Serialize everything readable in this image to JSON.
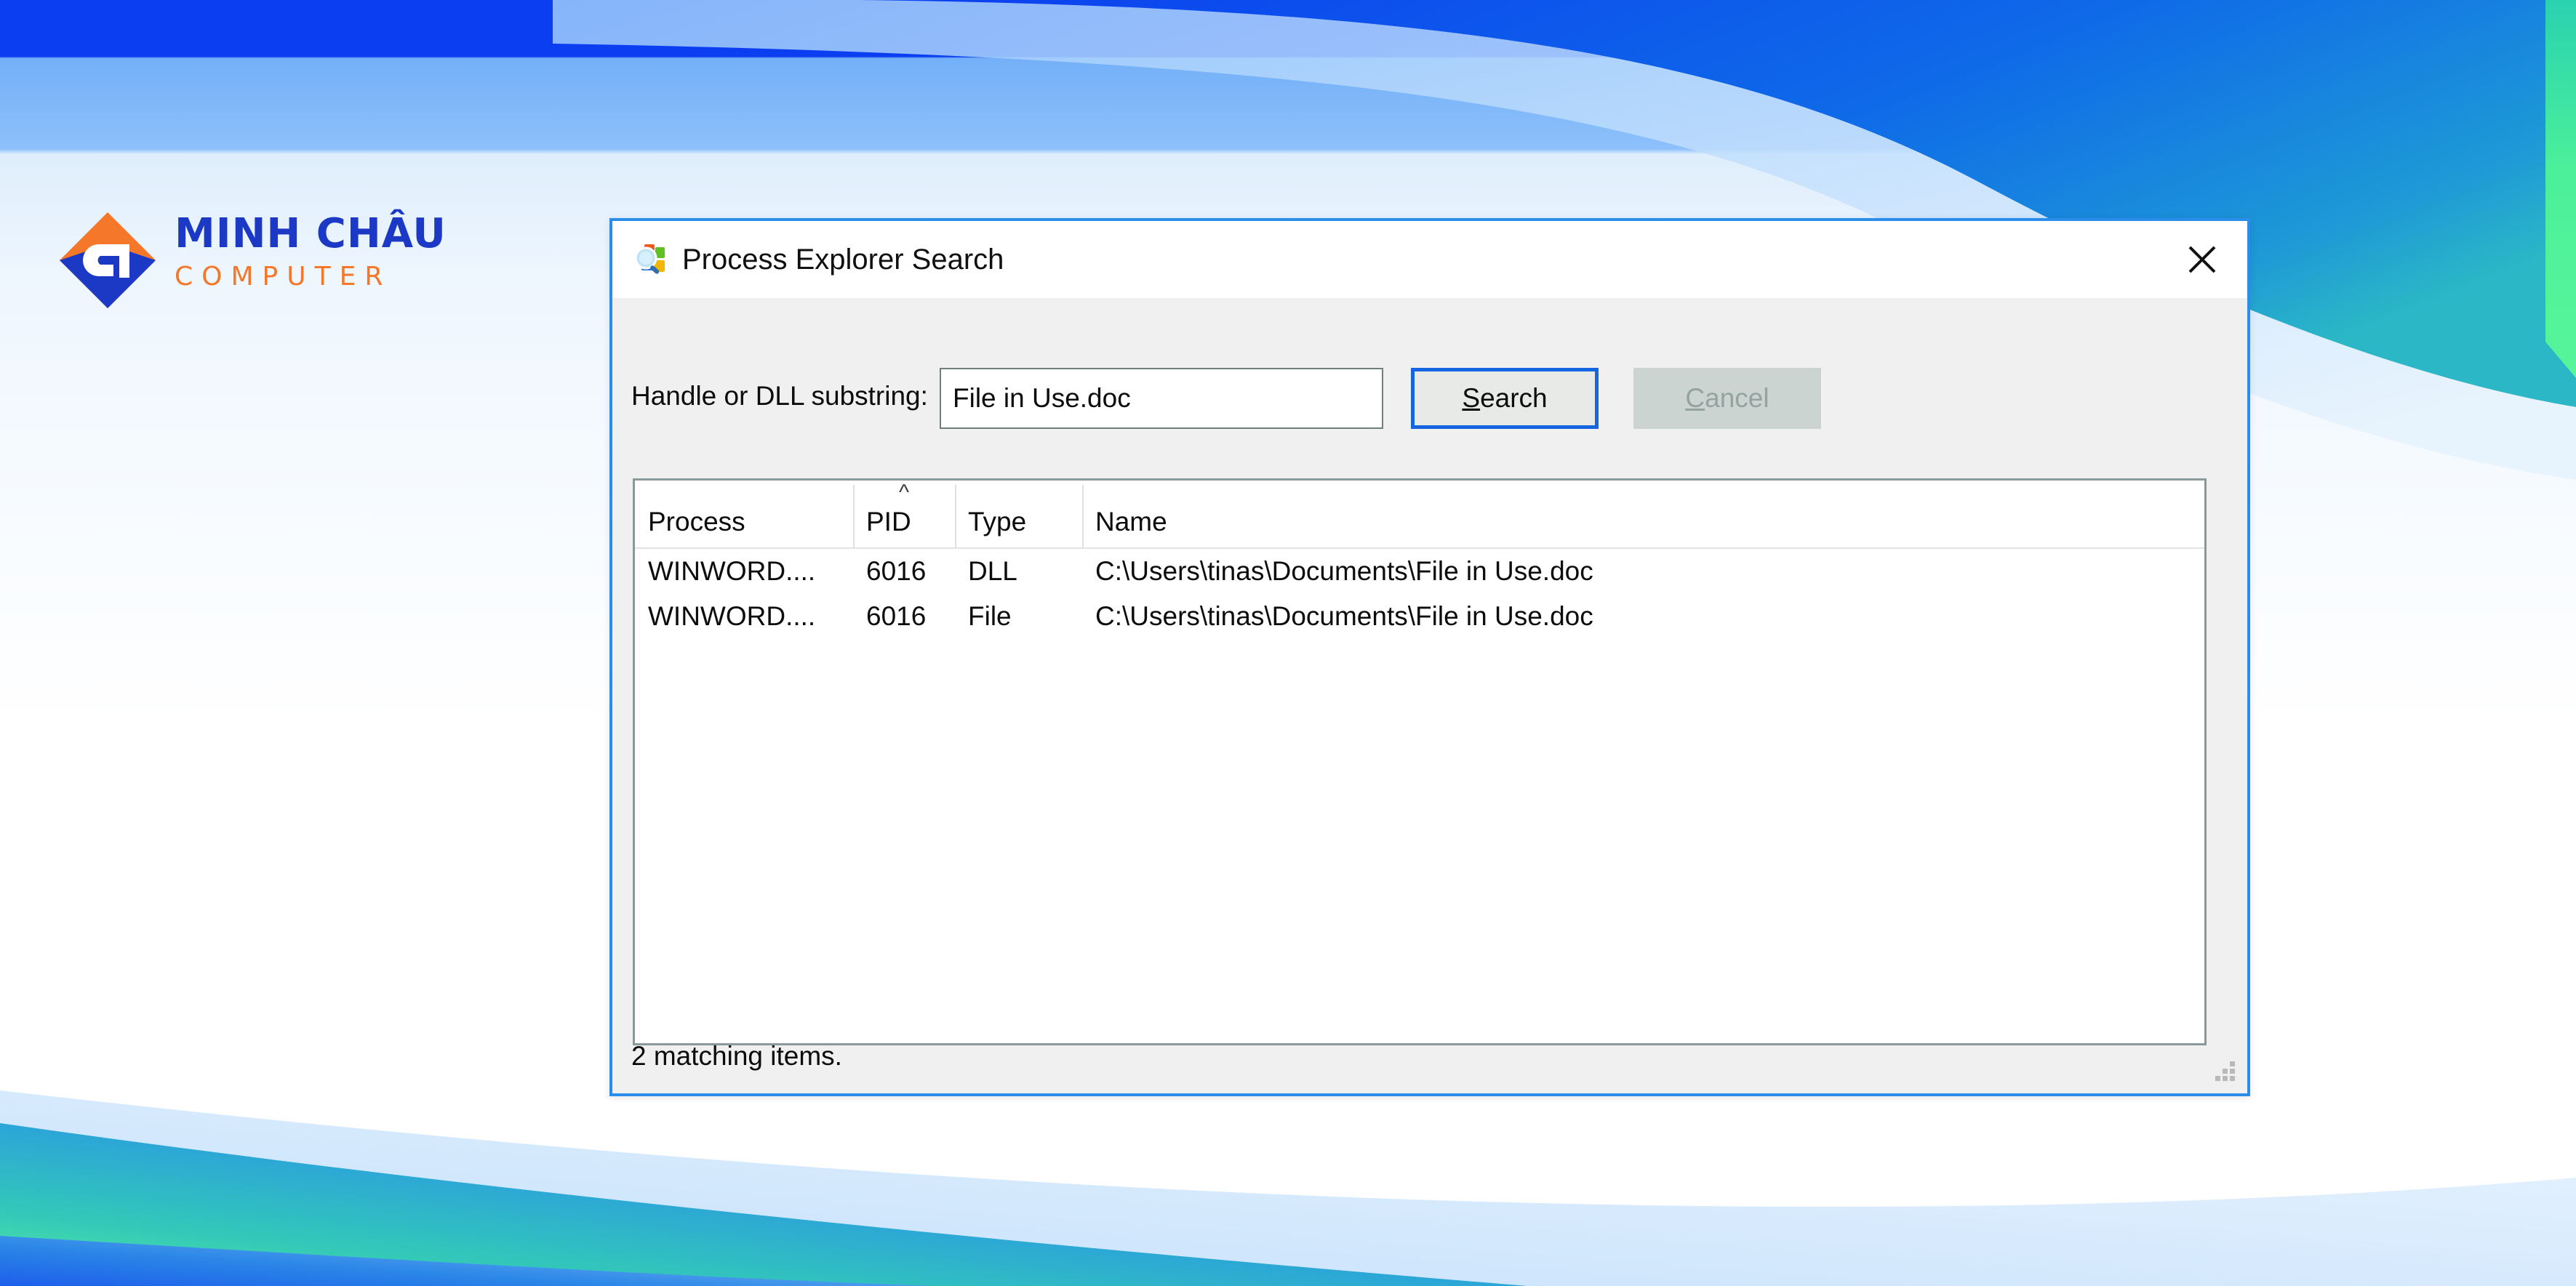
{
  "branding": {
    "logo_line1": "MINH CHÂU",
    "logo_line2": "COMPUTER",
    "logo_mark_icon": "diamond-logo-icon",
    "orange": "#f4772a",
    "blue": "#1b39c4"
  },
  "dialog": {
    "title": "Process Explorer Search",
    "title_icon": "process-explorer-icon",
    "close_icon": "close-icon",
    "accent_border": "#2a8dea"
  },
  "search": {
    "label": "Handle or DLL substring:",
    "value": "File in Use.doc",
    "placeholder": "",
    "search_button": {
      "accel": "S",
      "rest": "earch",
      "focused": true
    },
    "cancel_button": {
      "accel": "C",
      "rest": "ancel",
      "disabled": true
    }
  },
  "results": {
    "columns": [
      {
        "label": "Process",
        "sorted": false,
        "sort_caret": ""
      },
      {
        "label": "PID",
        "sorted": true,
        "sort_caret": "^"
      },
      {
        "label": "Type",
        "sorted": false,
        "sort_caret": ""
      },
      {
        "label": "Name",
        "sorted": false,
        "sort_caret": ""
      }
    ],
    "rows": [
      {
        "process": "WINWORD....",
        "pid": "6016",
        "type": "DLL",
        "name": "C:\\Users\\tinas\\Documents\\File in Use.doc"
      },
      {
        "process": "WINWORD....",
        "pid": "6016",
        "type": "File",
        "name": "C:\\Users\\tinas\\Documents\\File in Use.doc"
      }
    ]
  },
  "statusbar": {
    "text": "2 matching items.",
    "grip_icon": "resize-grip-icon"
  }
}
